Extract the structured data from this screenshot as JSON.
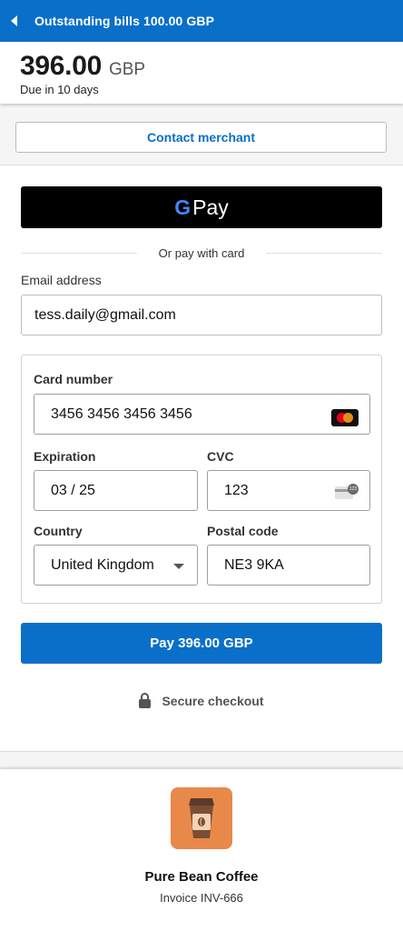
{
  "header": {
    "title": "Outstanding bills 100.00 GBP",
    "amount": "396.00",
    "currency": "GBP",
    "due": "Due in 10 days"
  },
  "actions": {
    "contact_label": "Contact merchant",
    "gpay_g": "G",
    "gpay_pay": "Pay",
    "or_text": "Or pay with card"
  },
  "form": {
    "email_label": "Email address",
    "email_value": "tess.daily@gmail.com",
    "card_number_label": "Card number",
    "card_number_value": "3456 3456 3456 3456",
    "expiration_label": "Expiration",
    "expiration_value": "03 / 25",
    "cvc_label": "CVC",
    "cvc_value": "123",
    "cvc_badge": "123",
    "country_label": "Country",
    "country_value": "United Kingdom",
    "postal_label": "Postal code",
    "postal_value": "NE3 9KA",
    "pay_label": "Pay 396.00 GBP",
    "secure_label": "Secure checkout"
  },
  "merchant": {
    "name": "Pure Bean Coffee",
    "invoice": "Invoice INV-666"
  },
  "colors": {
    "brand_blue": "#0a6fc8",
    "logo_orange": "#e8894a"
  }
}
